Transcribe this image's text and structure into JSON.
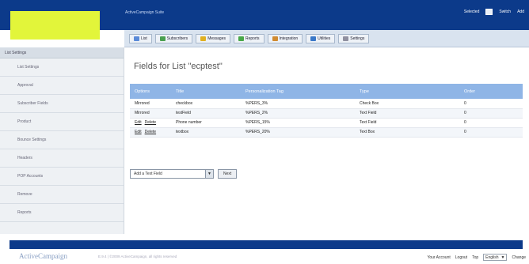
{
  "header": {
    "brand_text": "ActiveCampaign Suite",
    "user_links": [
      "Selected",
      "Switch",
      "Add"
    ]
  },
  "tabs": [
    {
      "label": "List",
      "icon": "list-icon",
      "color": "#5a8ad8"
    },
    {
      "label": "Subscribers",
      "icon": "subscribers-icon",
      "color": "#4aa050"
    },
    {
      "label": "Messages",
      "icon": "messages-icon",
      "color": "#e0b020"
    },
    {
      "label": "Reports",
      "icon": "reports-icon",
      "color": "#48a848"
    },
    {
      "label": "Integration",
      "icon": "integration-icon",
      "color": "#d08a30"
    },
    {
      "label": "Utilities",
      "icon": "utilities-icon",
      "color": "#3a78c8"
    },
    {
      "label": "Settings",
      "icon": "settings-icon",
      "color": "#9090a0"
    }
  ],
  "sidebar": {
    "header": "List Settings",
    "items": [
      "List Settings",
      "Approval",
      "Subscriber Fields",
      "Product",
      "Bounce Settings",
      "Headers",
      "POP Accounts",
      "Remove",
      "Reports"
    ]
  },
  "main": {
    "title": "Fields for List \"ecptest\"",
    "columns": [
      "Options",
      "Title",
      "Personalization Tag",
      "Type",
      "Order"
    ],
    "rows": [
      {
        "options": "Mirrored",
        "links": [],
        "title": "checkbox",
        "tag": "%PERS_3%",
        "type": "Check Box",
        "order": "0"
      },
      {
        "options": "Mirrored",
        "links": [],
        "title": "testField",
        "tag": "%PERS_2%",
        "type": "Text Field",
        "order": "0"
      },
      {
        "options": "",
        "links": [
          "Edit",
          "Delete"
        ],
        "title": "Phone number",
        "tag": "%PERS_15%",
        "type": "Text Field",
        "order": "0"
      },
      {
        "options": "",
        "links": [
          "Edit",
          "Delete"
        ],
        "title": "textbox",
        "tag": "%PERS_20%",
        "type": "Text Box",
        "order": "0"
      }
    ],
    "add_select_value": "Add a Text Field",
    "next_button": "Next"
  },
  "footer": {
    "brand": "ActiveCampaign",
    "version": "E.9.4 | ©2009 ActiveCampaign, all rights reserved",
    "links": [
      "Your Account",
      "Logout",
      "Top"
    ],
    "language": "English",
    "change_button": "Change"
  }
}
